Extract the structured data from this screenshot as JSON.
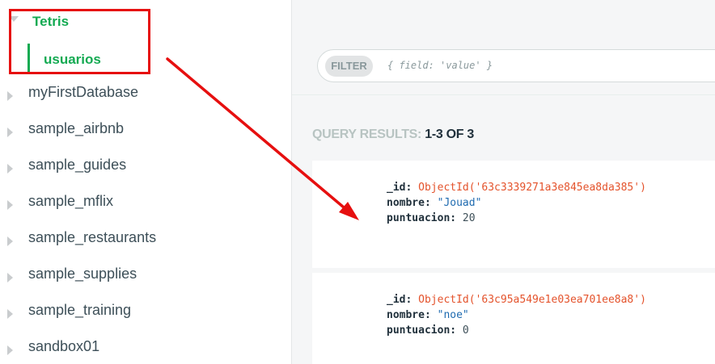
{
  "sidebar": {
    "active_database": "Tetris",
    "active_collection": "usuarios",
    "databases": [
      "myFirstDatabase",
      "sample_airbnb",
      "sample_guides",
      "sample_mflix",
      "sample_restaurants",
      "sample_supplies",
      "sample_training",
      "sandbox01"
    ]
  },
  "filter": {
    "badge": "FILTER",
    "placeholder": "{ field: 'value' }"
  },
  "results": {
    "label": "QUERY RESULTS:",
    "range": "1-3 OF 3",
    "documents": [
      {
        "id_key": "_id:",
        "id_value": "ObjectId('63c3339271a3e845ea8da385')",
        "nombre_key": "nombre:",
        "nombre_value": "\"Jouad\"",
        "puntuacion_key": "puntuacion:",
        "puntuacion_value": "20"
      },
      {
        "id_key": "_id:",
        "id_value": "ObjectId('63c95a549e1e03ea701ee8a8')",
        "nombre_key": "nombre:",
        "nombre_value": "\"noe\"",
        "puntuacion_key": "puntuacion:",
        "puntuacion_value": "0"
      }
    ]
  },
  "colors": {
    "accent_green": "#13aa52",
    "annotation_red": "#e60f0f",
    "objectid": "#e4532c",
    "string": "#1f6bb0"
  }
}
